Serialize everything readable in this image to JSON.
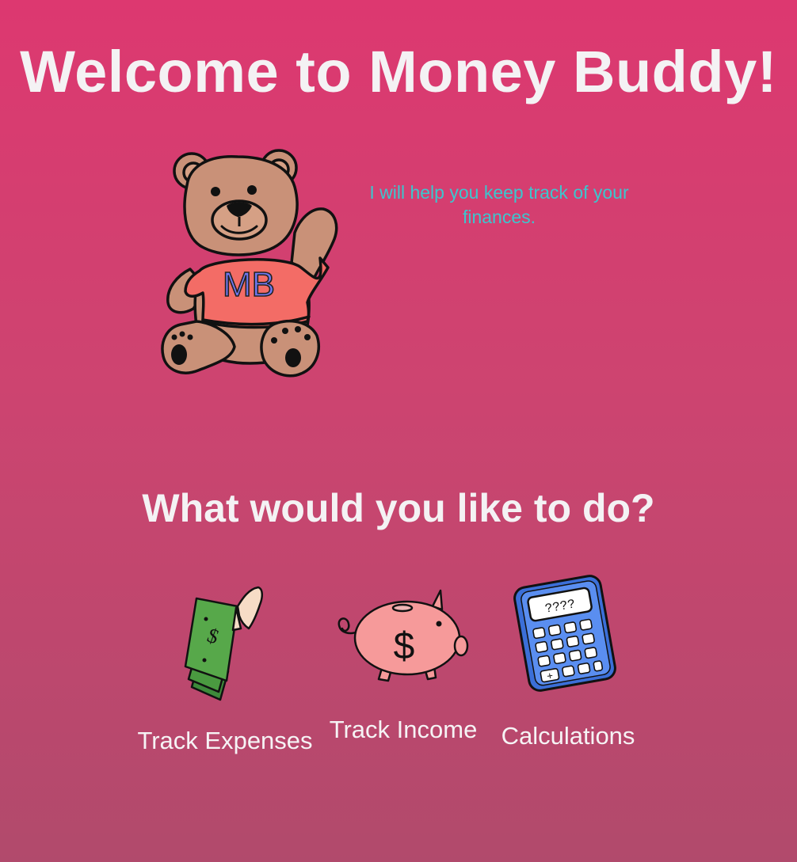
{
  "header": {
    "title": "Welcome to Money Buddy!"
  },
  "mascot": {
    "icon": "teddy-bear-icon",
    "shirt_text": "MB",
    "colors": {
      "fur": "#c99178",
      "shirt": "#f36c66",
      "shirt_text": "#6a6fe8"
    }
  },
  "intro": {
    "tagline": "I will help you keep track of your finances.",
    "color": "#3cc6ce"
  },
  "actions": {
    "heading": "What would you like to do?",
    "items": [
      {
        "label": "Track Expenses",
        "icon": "cash-in-hand-icon"
      },
      {
        "label": "Track Income",
        "icon": "piggy-bank-icon"
      },
      {
        "label": "Calculations",
        "icon": "calculator-icon"
      }
    ]
  },
  "theme": {
    "background_top": "#dd3870",
    "background_bottom": "#b14a6c",
    "text": "#f4f2f4"
  }
}
